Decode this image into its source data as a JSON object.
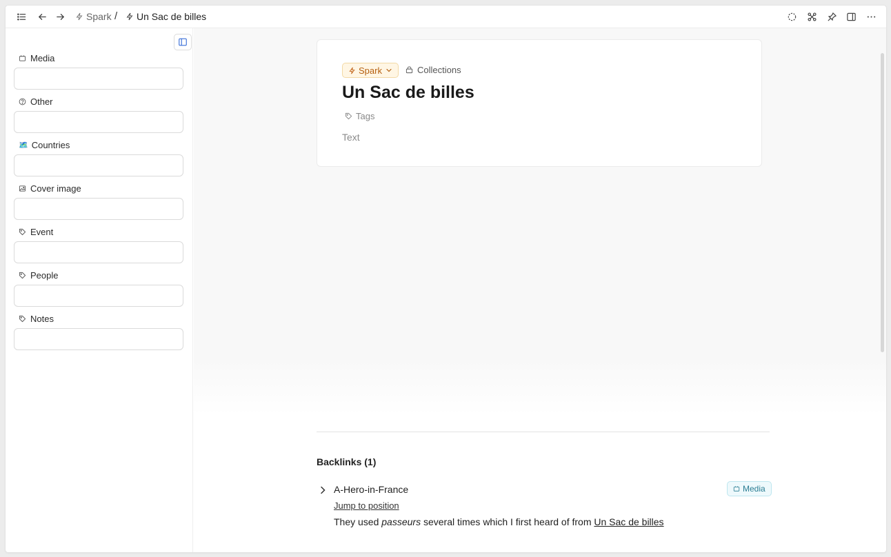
{
  "breadcrumb": {
    "parent": "Spark",
    "separator": "/",
    "current": "Un Sac de billes"
  },
  "sidebar": {
    "properties": [
      {
        "label": "Media",
        "icon": "calendar-box-icon"
      },
      {
        "label": "Other",
        "icon": "question-circle-icon"
      },
      {
        "label": "Countries",
        "icon": "map-emoji-icon",
        "emoji": "🗺️"
      },
      {
        "label": "Cover image",
        "icon": "image-icon"
      },
      {
        "label": "Event",
        "icon": "tag-icon"
      },
      {
        "label": "People",
        "icon": "tag-icon"
      },
      {
        "label": "Notes",
        "icon": "tag-icon"
      }
    ]
  },
  "card": {
    "type_label": "Spark",
    "collections_label": "Collections",
    "title": "Un Sac de billes",
    "tags_label": "Tags",
    "text_placeholder": "Text"
  },
  "backlinks": {
    "heading": "Backlinks (1)",
    "items": [
      {
        "title": "A-Hero-in-France",
        "badge": "Media",
        "jump_label": "Jump to position",
        "snippet_before": "They used ",
        "snippet_italic": "passeurs",
        "snippet_middle": " several times which I first heard of from ",
        "snippet_link": "Un Sac de billes"
      }
    ]
  },
  "colors": {
    "type_chip_text": "#b55f10",
    "type_chip_bg": "#fff6e4",
    "media_badge_text": "#2a7d93",
    "media_badge_bg": "#eef9fc",
    "sidebar_toggle_accent": "#3a6fd8"
  }
}
